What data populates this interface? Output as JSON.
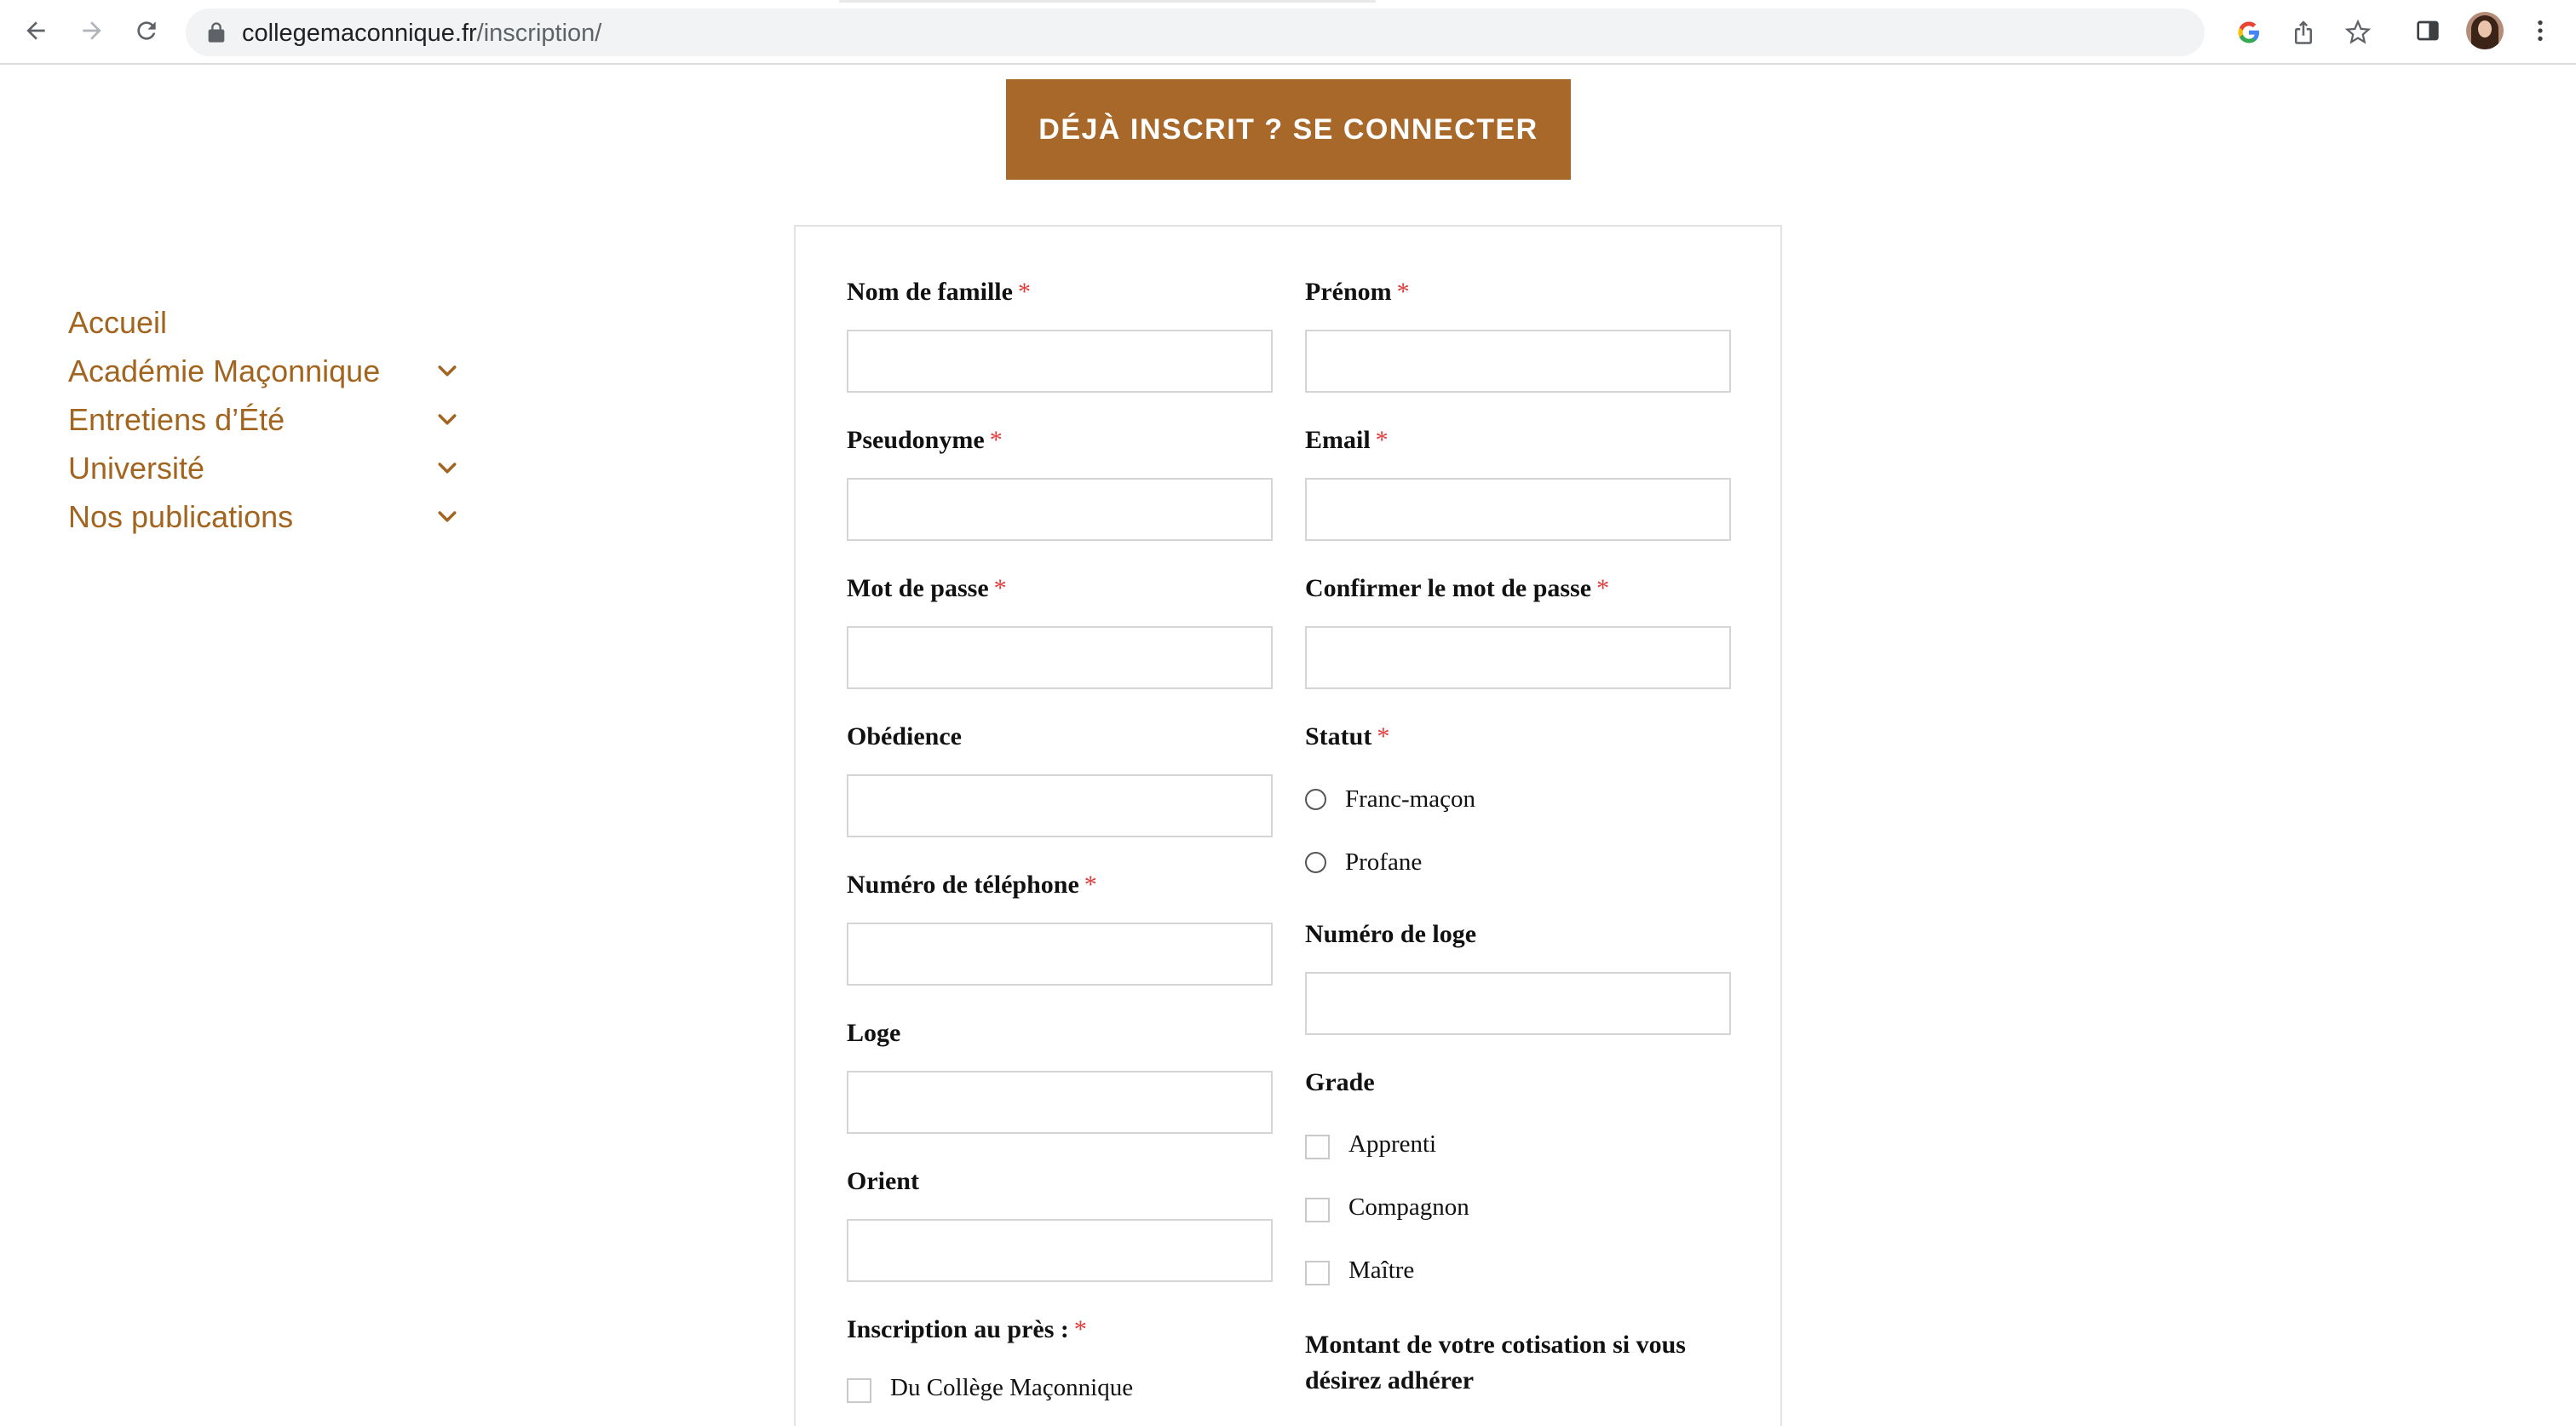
{
  "browser": {
    "url_domain": "collegemaconnique.fr",
    "url_path": "/inscription/"
  },
  "page": {
    "login_button": "DÉJÀ INSCRIT ? SE CONNECTER",
    "sidebar": {
      "items": [
        {
          "label": "Accueil",
          "has_submenu": false
        },
        {
          "label": "Académie Maçonnique",
          "has_submenu": true
        },
        {
          "label": "Entretiens d’Été",
          "has_submenu": true
        },
        {
          "label": "Université",
          "has_submenu": true
        },
        {
          "label": "Nos publications",
          "has_submenu": true
        }
      ]
    },
    "form": {
      "required_mark": "*",
      "last_name": {
        "label": "Nom de famille",
        "value": "",
        "required": true
      },
      "first_name": {
        "label": "Prénom",
        "value": "",
        "required": true
      },
      "pseudonym": {
        "label": "Pseudonyme",
        "value": "",
        "required": true
      },
      "email": {
        "label": "Email",
        "value": "",
        "required": true
      },
      "password": {
        "label": "Mot de passe",
        "value": "",
        "required": true
      },
      "confirm_password": {
        "label": "Confirmer le mot de passe",
        "value": "",
        "required": true
      },
      "obedience": {
        "label": "Obédience",
        "value": "",
        "required": false
      },
      "status": {
        "label": "Statut",
        "required": true,
        "options": [
          "Franc-maçon",
          "Profane"
        ]
      },
      "phone": {
        "label": "Numéro de téléphone",
        "value": "",
        "required": true
      },
      "lodge_number": {
        "label": "Numéro de loge",
        "value": "",
        "required": false
      },
      "lodge": {
        "label": "Loge",
        "value": "",
        "required": false
      },
      "grade": {
        "label": "Grade",
        "required": false,
        "options": [
          "Apprenti",
          "Compagnon",
          "Maître"
        ]
      },
      "orient": {
        "label": "Orient",
        "value": "",
        "required": false
      },
      "registration_with": {
        "label": "Inscription au près :",
        "required": true,
        "options": [
          "Du Collège Maçonnique"
        ]
      },
      "contribution": {
        "label": "Montant de votre cotisation si vous désirez adhérer"
      }
    }
  },
  "colors": {
    "accent": "#a7682a",
    "nav_text": "#a2651f",
    "required": "#e23b3b"
  }
}
